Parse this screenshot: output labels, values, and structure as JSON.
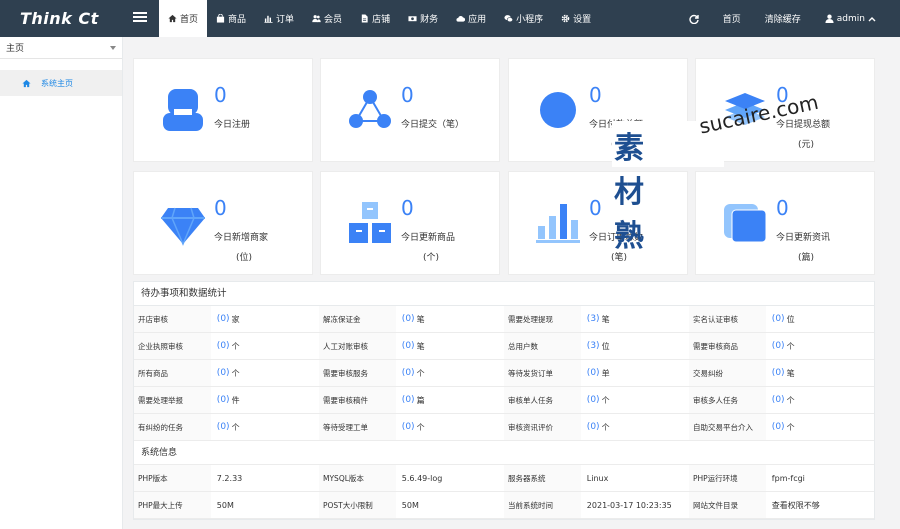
{
  "brand": "Think Ct",
  "nav": [
    {
      "label": "首页",
      "icon": "home-icon",
      "active": true
    },
    {
      "label": "商品",
      "icon": "bag-icon"
    },
    {
      "label": "订单",
      "icon": "bar-chart-icon"
    },
    {
      "label": "会员",
      "icon": "users-icon"
    },
    {
      "label": "店铺",
      "icon": "file-icon"
    },
    {
      "label": "财务",
      "icon": "money-icon"
    },
    {
      "label": "应用",
      "icon": "cloud-icon"
    },
    {
      "label": "小程序",
      "icon": "wechat-icon"
    },
    {
      "label": "设置",
      "icon": "gear-icon"
    }
  ],
  "right_nav": {
    "home": "首页",
    "clear_cache": "清除缓存",
    "user": "admin"
  },
  "sidebar": {
    "select": "主页",
    "item": "系统主页"
  },
  "cards": [
    {
      "value": "0",
      "label": "今日注册",
      "unit": ""
    },
    {
      "value": "0",
      "label": "今日提交（笔）",
      "unit": ""
    },
    {
      "value": "0",
      "label": "今日付款总额",
      "unit": "(元)"
    },
    {
      "value": "0",
      "label": "今日提现总额",
      "unit": "(元)"
    },
    {
      "value": "0",
      "label": "今日新增商家",
      "unit": "(位)"
    },
    {
      "value": "0",
      "label": "今日更新商品",
      "unit": "(个)"
    },
    {
      "value": "0",
      "label": "今日订单总数",
      "unit": "(笔)"
    },
    {
      "value": "0",
      "label": "今日更新资讯",
      "unit": "(篇)"
    }
  ],
  "stats": {
    "title": "待办事项和数据统计",
    "rows": [
      [
        [
          "开店审核",
          "0",
          "家"
        ],
        [
          "解冻保证金",
          "0",
          "笔"
        ],
        [
          "需要处理提现",
          "3",
          "笔"
        ],
        [
          "实名认证审核",
          "0",
          "位"
        ]
      ],
      [
        [
          "企业执照审核",
          "0",
          "个"
        ],
        [
          "人工对账审核",
          "0",
          "笔"
        ],
        [
          "总用户数",
          "3",
          "位"
        ],
        [
          "需要审核商品",
          "0",
          "个"
        ]
      ],
      [
        [
          "所有商品",
          "0",
          "个"
        ],
        [
          "需要审核服务",
          "0",
          "个"
        ],
        [
          "等待发货订单",
          "0",
          "单"
        ],
        [
          "交易纠纷",
          "0",
          "笔"
        ]
      ],
      [
        [
          "需要处理举报",
          "0",
          "件"
        ],
        [
          "需要审核稿件",
          "0",
          "篇"
        ],
        [
          "审核单人任务",
          "0",
          "个"
        ],
        [
          "审核多人任务",
          "0",
          "个"
        ]
      ],
      [
        [
          "有纠纷的任务",
          "0",
          "个"
        ],
        [
          "等待受理工单",
          "0",
          "个"
        ],
        [
          "审核资讯评价",
          "0",
          "个"
        ],
        [
          "自助交易平台介入",
          "0",
          "个"
        ]
      ]
    ]
  },
  "system": {
    "title": "系统信息",
    "rows": [
      [
        [
          "PHP版本",
          "7.2.33"
        ],
        [
          "MYSQL版本",
          "5.6.49-log"
        ],
        [
          "服务器系统",
          "Linux"
        ],
        [
          "PHP运行环境",
          "fpm-fcgi"
        ]
      ],
      [
        [
          "PHP最大上传",
          "50M"
        ],
        [
          "POST大小限制",
          "50M"
        ],
        [
          "当前系统时间",
          "2021-03-17 10:23:35"
        ],
        [
          "网站文件目录",
          "查看权限不够"
        ]
      ]
    ]
  },
  "watermark": {
    "cn": "素材熟",
    "en": "sucaire.com"
  },
  "colors": {
    "topbar": "#2f4050",
    "accent": "#3b82f6"
  }
}
